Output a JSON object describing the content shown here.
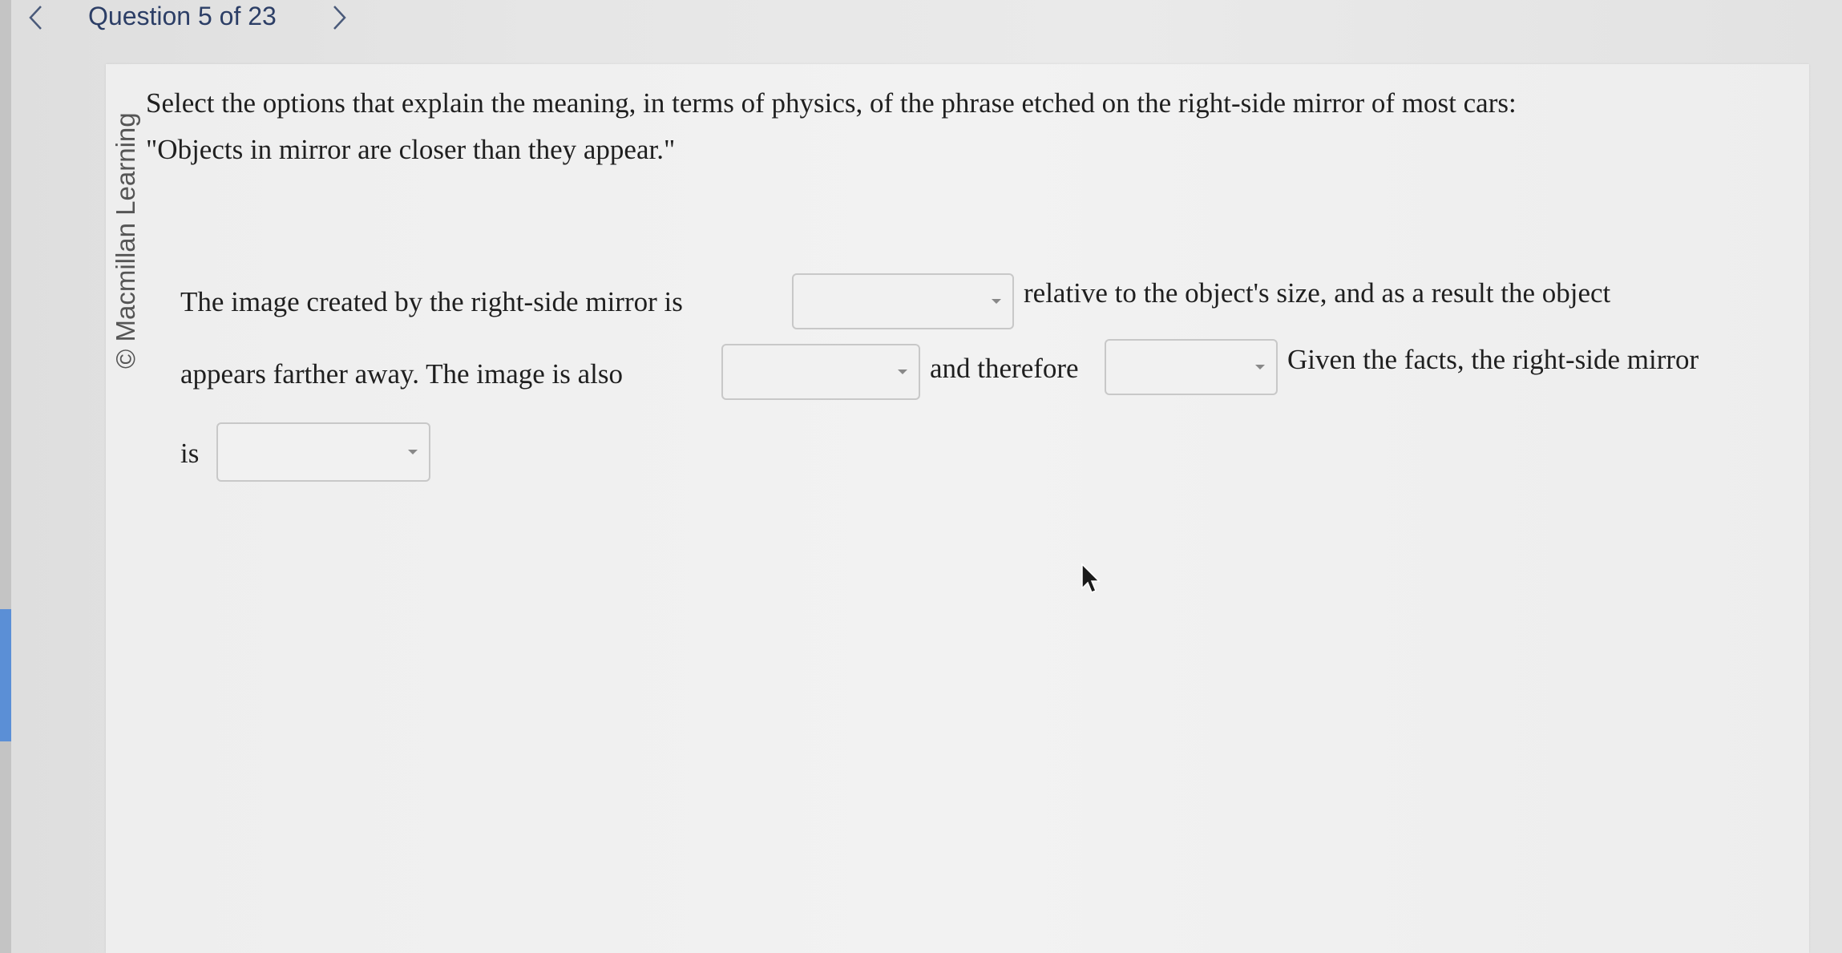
{
  "header": {
    "question_counter": "Question 5 of 23",
    "prev_icon": "chevron-left-icon",
    "next_icon": "chevron-right-icon"
  },
  "copyright": "© Macmillan Learning",
  "question": {
    "prompt_line1": "Select the options that explain the meaning, in terms of physics, of the phrase etched on the right-side mirror of most cars:",
    "prompt_line2": "\"Objects in mirror are closer than they appear.\"",
    "sentence": {
      "part1": "The image created by the right-side mirror is",
      "part2": "relative to the object's size, and as a result the object",
      "part3": "appears farther away. The image is also",
      "part4": "and therefore",
      "part5": "Given the facts, the right-side mirror",
      "part6": "is"
    },
    "dropdowns": [
      {
        "selected": ""
      },
      {
        "selected": ""
      },
      {
        "selected": ""
      },
      {
        "selected": ""
      }
    ]
  },
  "colors": {
    "accent": "#5b8fd6",
    "header_text": "#2c3e66"
  }
}
